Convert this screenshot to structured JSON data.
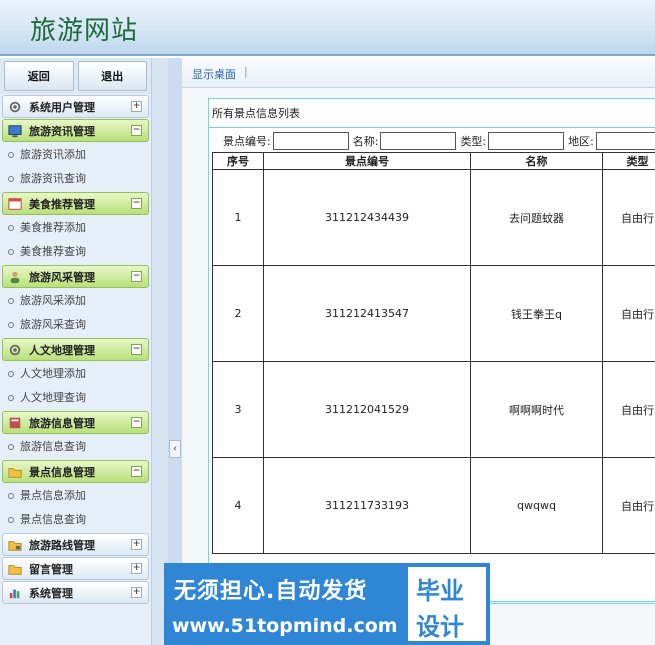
{
  "site": {
    "title": "旅游网站"
  },
  "sidebar": {
    "back_label": "返回",
    "logout_label": "退出",
    "sections": [
      {
        "label": "系统用户管理",
        "icon": "gear-icon",
        "expanded": false,
        "items": []
      },
      {
        "label": "旅游资讯管理",
        "icon": "monitor-icon",
        "expanded": true,
        "items": [
          "旅游资讯添加",
          "旅游资讯查询"
        ]
      },
      {
        "label": "美食推荐管理",
        "icon": "calendar-icon",
        "expanded": true,
        "items": [
          "美食推荐添加",
          "美食推荐查询"
        ]
      },
      {
        "label": "旅游风采管理",
        "icon": "user-icon",
        "expanded": true,
        "items": [
          "旅游风采添加",
          "旅游风采查询"
        ]
      },
      {
        "label": "人文地理管理",
        "icon": "gear-icon",
        "expanded": true,
        "items": [
          "人文地理添加",
          "人文地理查询"
        ]
      },
      {
        "label": "旅游信息管理",
        "icon": "book-icon",
        "expanded": true,
        "items": [
          "旅游信息查询"
        ]
      },
      {
        "label": "景点信息管理",
        "icon": "folder-icon",
        "expanded": true,
        "items": [
          "景点信息添加",
          "景点信息查询"
        ]
      },
      {
        "label": "旅游路线管理",
        "icon": "folder-lock-icon",
        "expanded": false,
        "items": []
      },
      {
        "label": "留言管理",
        "icon": "folder-icon",
        "expanded": false,
        "items": []
      },
      {
        "label": "系统管理",
        "icon": "chart-icon",
        "expanded": false,
        "items": []
      }
    ]
  },
  "breadcrumb": {
    "label": "显示桌面",
    "sep": "|"
  },
  "panel": {
    "title": "所有景点信息列表",
    "search": {
      "code_label": "景点编号:",
      "name_label": "名称:",
      "type_label": "类型:",
      "region_label": "地区:"
    },
    "table": {
      "headers": [
        "序号",
        "景点编号",
        "名称",
        "类型"
      ],
      "rows": [
        [
          "1",
          "311212434439",
          "去问题蚊器",
          "自由行"
        ],
        [
          "2",
          "311212413547",
          "钱王拳王q",
          "自由行"
        ],
        [
          "3",
          "311212041529",
          "啊啊啊时代",
          "自由行"
        ],
        [
          "4",
          "311211733193",
          "qwqwq",
          "自由行"
        ]
      ]
    }
  },
  "watermark": {
    "line1": "无须担心.自动发货",
    "line2": "www.51topmind.com",
    "right1": "毕业",
    "right2": "设计"
  },
  "colors": {
    "accent": "#1f6b3b",
    "active_menu": "#b8e07a",
    "panel_border": "#6fd7e6",
    "watermark": "#2f86d4"
  }
}
